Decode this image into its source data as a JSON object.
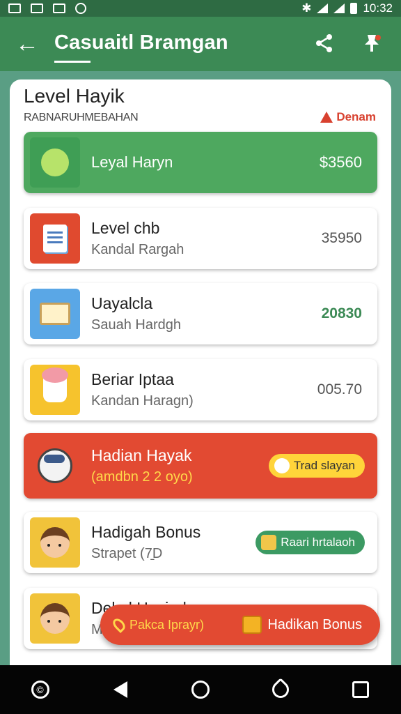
{
  "status_bar": {
    "time": "10:32",
    "left_icons": [
      "notification-icon",
      "image-icon",
      "photo-icon",
      "vpn-icon"
    ],
    "right_icons": [
      "bluetooth-icon",
      "wifi-icon",
      "signal-icon",
      "battery-icon"
    ]
  },
  "app_bar": {
    "title": "Casuaitl Bramgan",
    "back_icon": "arrow-left-icon",
    "share_icon": "share-icon",
    "pin_icon": "pin-icon"
  },
  "card": {
    "title": "Level Hayik",
    "subtitle": "RABNARUHMEBAHAN",
    "alert_label": "Denam",
    "rows": [
      {
        "title": "Leyal Haryn",
        "subtitle": "",
        "value": "$3560",
        "style": "green"
      },
      {
        "title": "Level chb",
        "subtitle": "Kandal Rargah",
        "value": "35950",
        "style": "white"
      },
      {
        "title": "Uayalcla",
        "subtitle": "Sauah Hardgh",
        "value": "20830",
        "style": "white"
      },
      {
        "title": "Beriar Iptaa",
        "subtitle": "Kandan Haragn)",
        "value": "005.70",
        "style": "white"
      },
      {
        "title": "Hadian Hayak",
        "subtitle": "(amdbn 2 2 oyo)",
        "pill": "Trad slayan",
        "style": "red"
      },
      {
        "title": "Hadigah Bonus",
        "subtitle": "Strapet (7̱D",
        "pill": "Raari hrtalaoh",
        "style": "white"
      },
      {
        "title": "Dekal Hasind",
        "subtitle": "M",
        "style": "white"
      }
    ]
  },
  "fab": {
    "left_label": "Pakca Iprayr)",
    "right_label": "Hadikan Bonus"
  },
  "nav_bar": {
    "icons": [
      "recent-apps-icon",
      "back-icon",
      "home-icon",
      "tag-icon",
      "overview-icon"
    ]
  },
  "colors": {
    "primary_green": "#3c8a55",
    "status_green": "#2e6b43",
    "accent_red": "#e24a32",
    "highlight_yellow": "#ffd43a"
  }
}
